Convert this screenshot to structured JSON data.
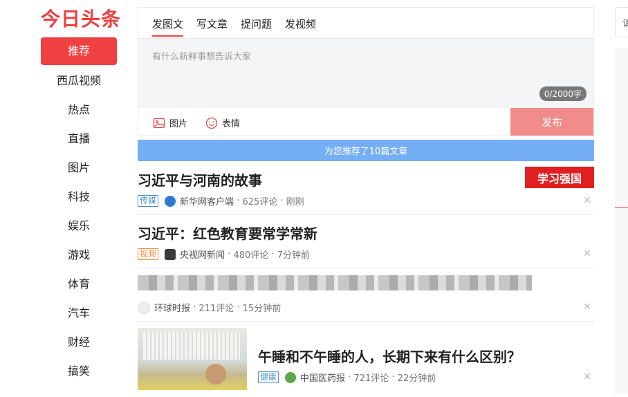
{
  "brand": {
    "logo_text": "今日头条",
    "accent_color": "#f04142"
  },
  "sidebar": {
    "items": [
      {
        "label": "推荐",
        "active": true
      },
      {
        "label": "西瓜视频"
      },
      {
        "label": "热点"
      },
      {
        "label": "直播"
      },
      {
        "label": "图片"
      },
      {
        "label": "科技"
      },
      {
        "label": "娱乐"
      },
      {
        "label": "游戏"
      },
      {
        "label": "体育"
      },
      {
        "label": "汽车"
      },
      {
        "label": "财经"
      },
      {
        "label": "搞笑"
      }
    ]
  },
  "composer": {
    "tabs": [
      {
        "label": "发图文",
        "active": true
      },
      {
        "label": "写文章"
      },
      {
        "label": "提问题"
      },
      {
        "label": "发视频"
      }
    ],
    "placeholder": "有什么新鲜事想告诉大家",
    "counter": "0/2000字",
    "tools": [
      {
        "label": "图片",
        "icon": "image-icon"
      },
      {
        "label": "表情",
        "icon": "emoji-icon"
      }
    ],
    "publish_label": "发布"
  },
  "recommend_banner": "为您推荐了10篇文章",
  "feed": [
    {
      "title": "习近平与河南的故事",
      "tag": "传媒",
      "tag_color": "#4a90c2",
      "source": "新华网客户端",
      "comments": "625评论",
      "time": "刚刚",
      "thumb_text": "学习强国"
    },
    {
      "title": "习近平：红色教育要常学常新",
      "tag": "视频",
      "tag_color": "#f0883a",
      "source": "央视网新闻",
      "comments": "480评论",
      "time": "7分钟前"
    },
    {
      "title": "",
      "source": "环球时报",
      "comments": "211评论",
      "time": "15分钟前"
    },
    {
      "title": "午睡和不午睡的人，长期下来有什么区别？",
      "tag": "健康",
      "tag_color": "#4a90c2",
      "source": "中国医药报",
      "comments": "721评论",
      "time": "22分钟前"
    }
  ],
  "right": {
    "search_char": "请"
  }
}
